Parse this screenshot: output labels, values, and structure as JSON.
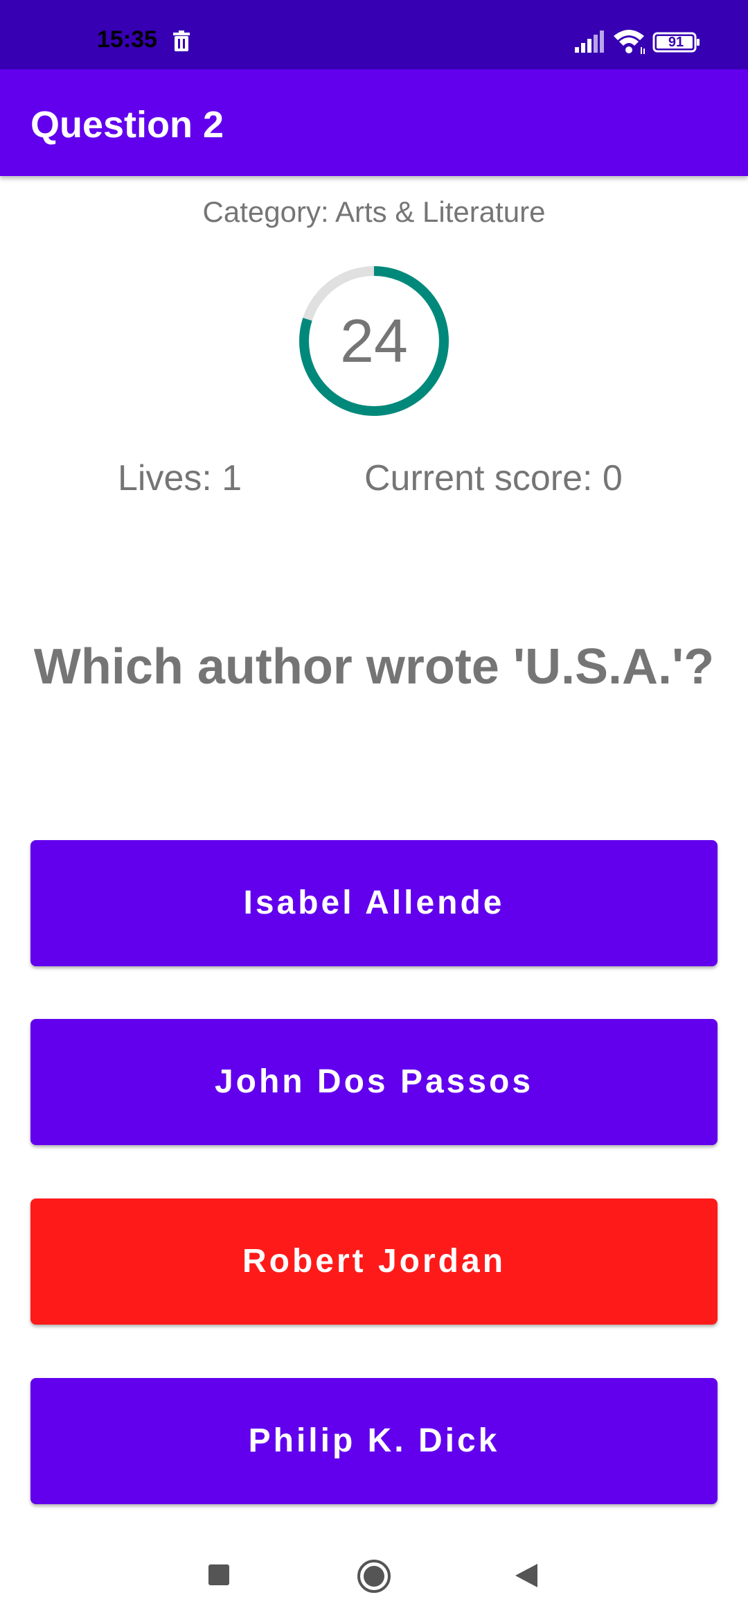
{
  "status_bar": {
    "time": "15:35",
    "battery": "91",
    "icons": [
      "trash-icon",
      "signal-icon",
      "wifi-icon",
      "battery-icon"
    ]
  },
  "app_bar": {
    "title": "Question 2"
  },
  "quiz": {
    "category": "Category: Arts & Literature",
    "timer_value": "24",
    "timer_progress": 0.8,
    "lives": "Lives: 1",
    "score": "Current score: 0",
    "question": "Which author wrote 'U.S.A.'?"
  },
  "answers": [
    {
      "label": "Isabel Allende",
      "state": "default"
    },
    {
      "label": "John Dos Passos",
      "state": "default"
    },
    {
      "label": "Robert Jordan",
      "state": "wrong"
    },
    {
      "label": "Philip K. Dick",
      "state": "default"
    }
  ],
  "colors": {
    "status_bar": "#3700b3",
    "primary": "#6200ee",
    "wrong": "#ff1a1a",
    "timer_ring": "#00897b",
    "timer_track": "#e0e0e0",
    "text_secondary": "#757575"
  },
  "nav_bar": {
    "icons": [
      "recents-icon",
      "home-icon",
      "back-icon"
    ]
  }
}
